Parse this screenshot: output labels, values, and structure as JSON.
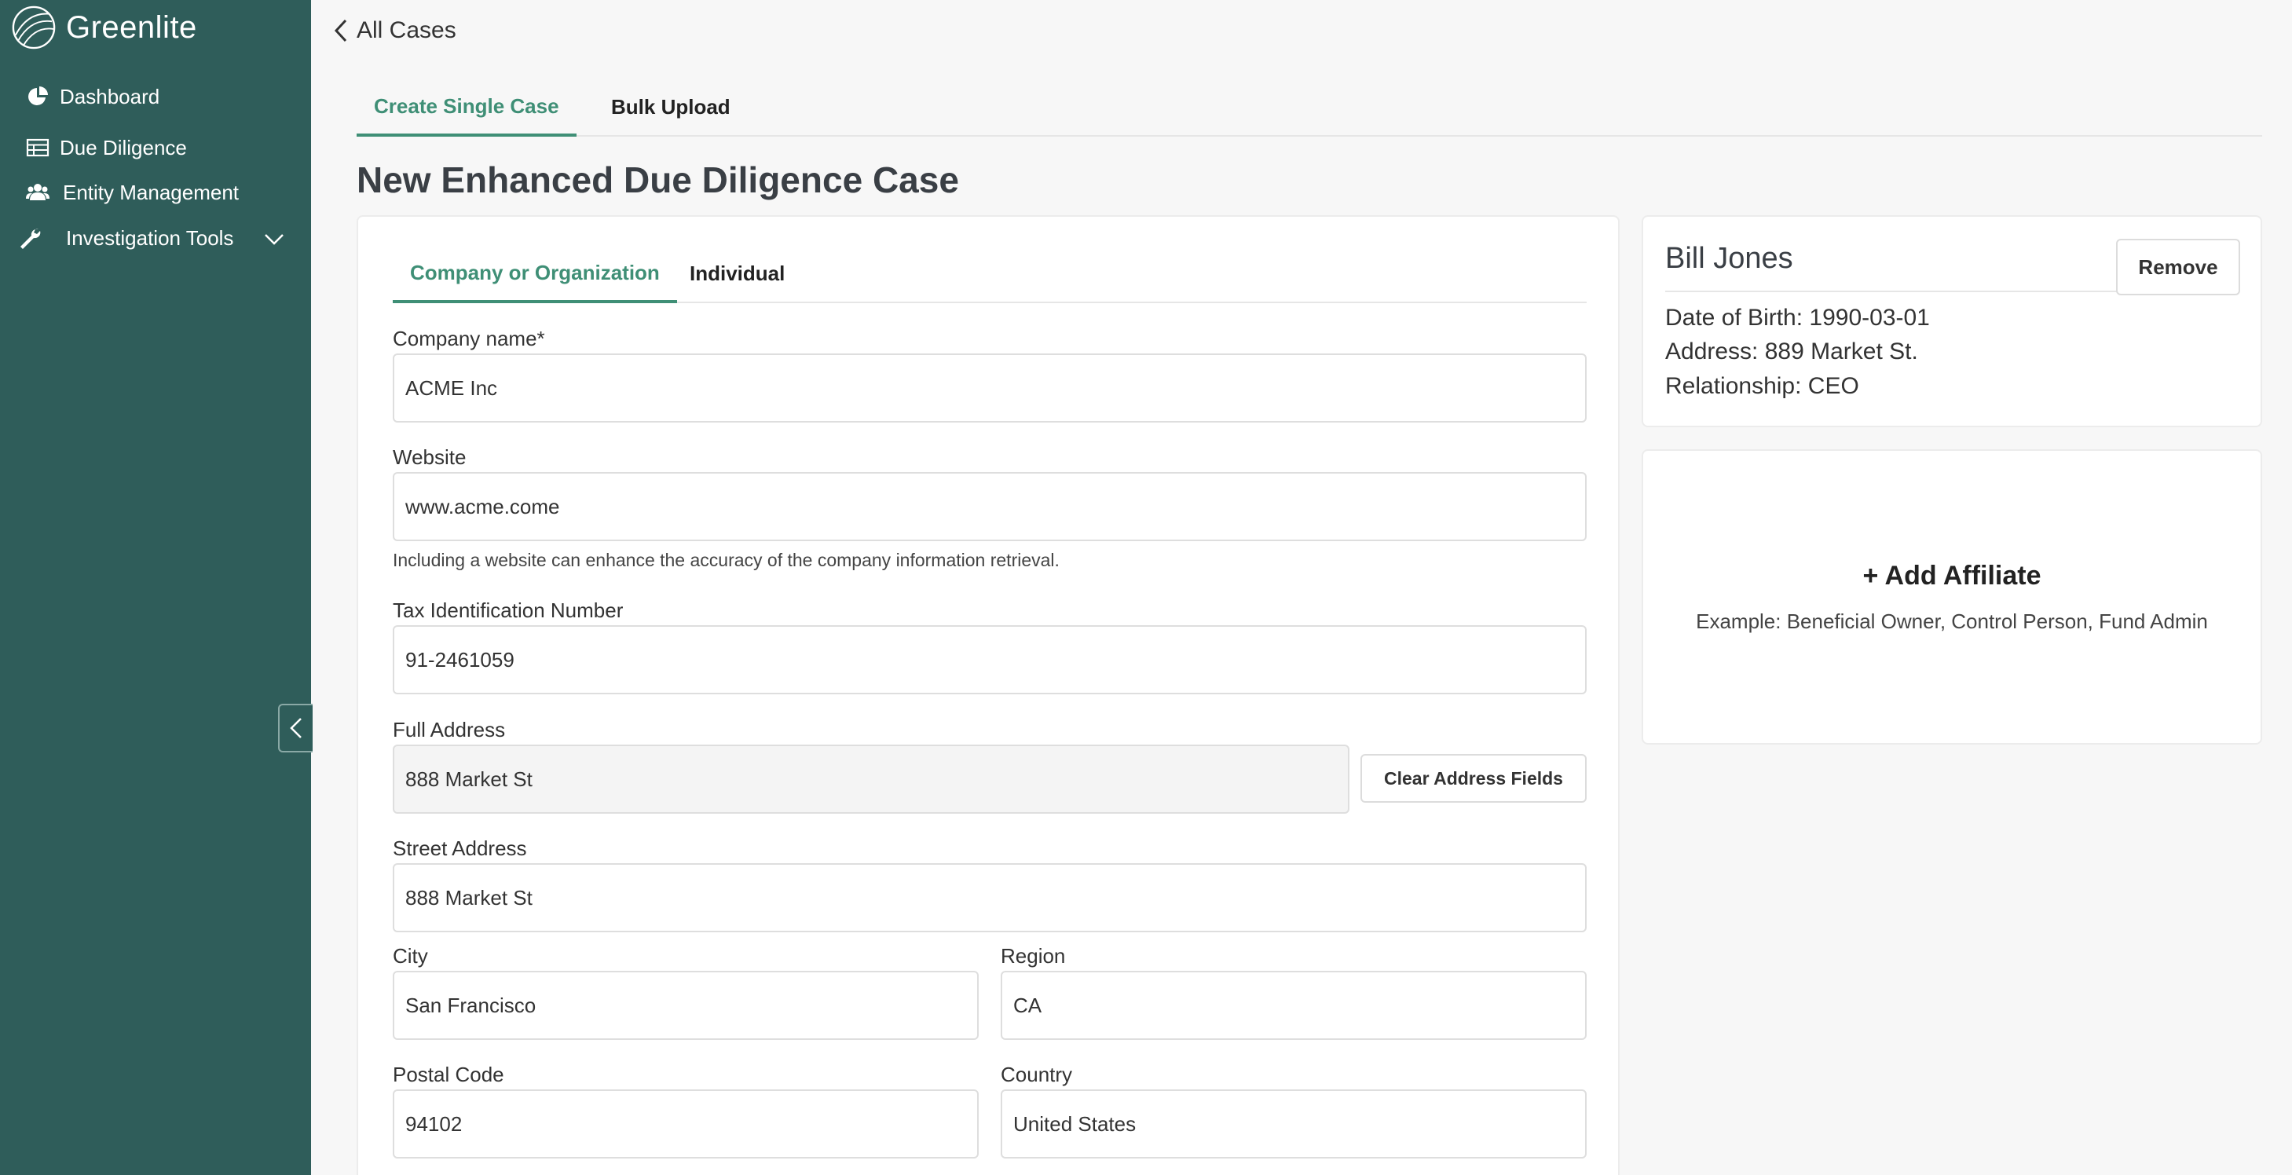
{
  "brand": {
    "name": "Greenlite"
  },
  "sidebar": {
    "items": [
      {
        "label": "Dashboard",
        "icon": "pie-chart-icon"
      },
      {
        "label": "Due Diligence",
        "icon": "table-icon"
      },
      {
        "label": "Entity Management",
        "icon": "users-icon"
      },
      {
        "label": "Investigation Tools",
        "icon": "wrench-icon"
      }
    ]
  },
  "nav": {
    "back_label": "All Cases"
  },
  "top_tabs": [
    {
      "label": "Create Single Case",
      "active": true
    },
    {
      "label": "Bulk Upload",
      "active": false
    }
  ],
  "page_title": "New Enhanced Due Diligence Case",
  "form": {
    "tabs": [
      {
        "label": "Company or Organization",
        "active": true
      },
      {
        "label": "Individual",
        "active": false
      }
    ],
    "company_name": {
      "label": "Company name*",
      "value": "ACME Inc"
    },
    "website": {
      "label": "Website",
      "value": "www.acme.come",
      "helper": "Including a website can enhance the accuracy of the company information retrieval."
    },
    "tax_id": {
      "label": "Tax Identification Number",
      "value": "91-2461059"
    },
    "full_address": {
      "label": "Full Address",
      "value": "888 Market St",
      "clear_label": "Clear Address Fields"
    },
    "street": {
      "label": "Street Address",
      "value": "888 Market St"
    },
    "city": {
      "label": "City",
      "value": "San Francisco"
    },
    "region": {
      "label": "Region",
      "value": "CA"
    },
    "postal": {
      "label": "Postal Code",
      "value": "94102"
    },
    "country": {
      "label": "Country",
      "value": "United States"
    }
  },
  "affiliate": {
    "name": "Bill Jones",
    "remove_label": "Remove",
    "dob": "Date of Birth: 1990-03-01",
    "address": "Address: 889 Market St.",
    "relationship": "Relationship: CEO"
  },
  "add_affiliate": {
    "title": "+ Add Affiliate",
    "example": "Example: Beneficial Owner, Control Person, Fund Admin"
  },
  "colors": {
    "sidebar": "#2f5d5a",
    "accent": "#3f8f76"
  }
}
